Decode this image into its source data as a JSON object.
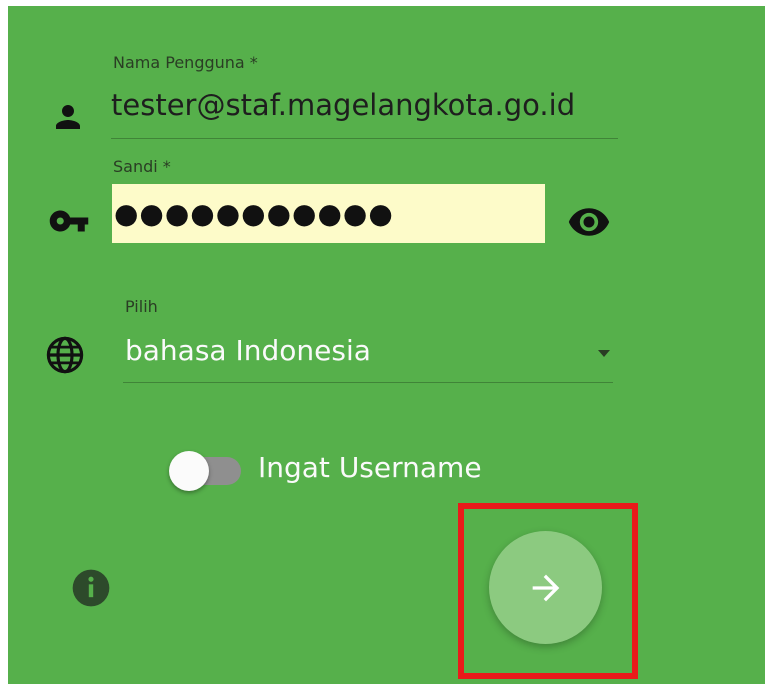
{
  "form": {
    "username": {
      "label": "Nama Pengguna *",
      "value": "tester@staf.magelangkota.go.id",
      "icon": "person-icon"
    },
    "password": {
      "label": "Sandi *",
      "masked_value": "●●●●●●●●●●●",
      "icon": "key-icon",
      "visibility_icon": "eye-icon"
    },
    "language": {
      "label": "Pilih",
      "selected": "bahasa Indonesia",
      "icon": "globe-icon"
    },
    "remember": {
      "label": "Ingat Username",
      "enabled": false
    },
    "submit_icon": "arrow-right-icon",
    "info_icon": "info-icon"
  },
  "colors": {
    "panel": "#56b04b",
    "password_bg": "#fdfbc9",
    "submit_button": "#8cca80",
    "highlight": "#ea1a1a"
  }
}
